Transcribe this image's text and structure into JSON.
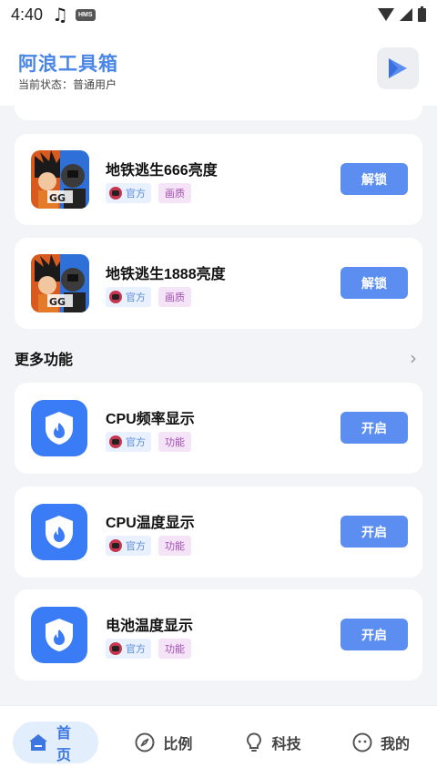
{
  "status_bar": {
    "time": "4:40",
    "badge": "HMS"
  },
  "header": {
    "title": "阿浪工具箱",
    "status_text": "当前状态：普通用户",
    "action_icon": "play-triangle-icon"
  },
  "game_cards": [
    {
      "title": "地铁逃生666亮度",
      "tag_official": "官方",
      "tag_type": "画质",
      "button": "解锁"
    },
    {
      "title": "地铁逃生1888亮度",
      "tag_official": "官方",
      "tag_type": "画质",
      "button": "解锁"
    }
  ],
  "section": {
    "title": "更多功能"
  },
  "feature_cards": [
    {
      "title": "CPU频率显示",
      "tag_official": "官方",
      "tag_type": "功能",
      "button": "开启"
    },
    {
      "title": "CPU温度显示",
      "tag_official": "官方",
      "tag_type": "功能",
      "button": "开启"
    },
    {
      "title": "电池温度显示",
      "tag_official": "官方",
      "tag_type": "功能",
      "button": "开启"
    }
  ],
  "nav": {
    "items": [
      {
        "label": "首页",
        "icon": "home-icon",
        "active": true
      },
      {
        "label": "比例",
        "icon": "compass-icon",
        "active": false
      },
      {
        "label": "科技",
        "icon": "lightbulb-icon",
        "active": false
      },
      {
        "label": "我的",
        "icon": "face-icon",
        "active": false
      }
    ]
  },
  "colors": {
    "accent": "#4a86e8",
    "button": "#5b8ef0",
    "feature_icon_bg": "#3a7cf5",
    "tag_official_bg": "#e8f1fd",
    "tag_type_bg": "#f5e4f7"
  }
}
